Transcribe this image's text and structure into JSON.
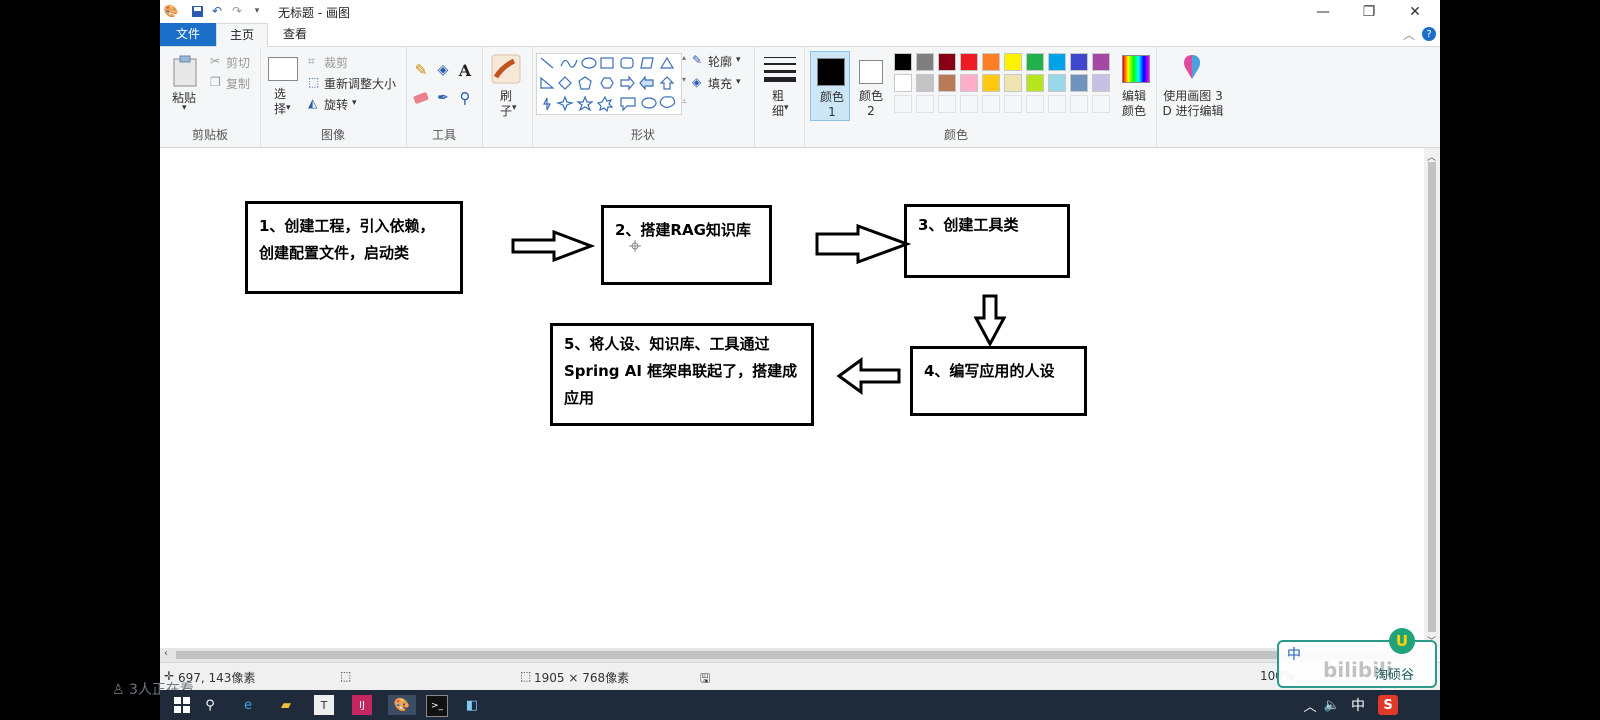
{
  "window": {
    "title": "无标题 - 画图",
    "controls": {
      "minimize": "—",
      "restore": "❐",
      "close": "✕"
    }
  },
  "tabs": {
    "file": "文件",
    "home": "主页",
    "view": "查看"
  },
  "ribbon": {
    "clipboard": {
      "paste": "粘贴",
      "cut": "剪切",
      "copy": "复制",
      "label": "剪贴板"
    },
    "image": {
      "select": "选择",
      "crop": "裁剪",
      "resize": "重新调整大小",
      "rotate": "旋转",
      "label": "图像"
    },
    "tools": {
      "label": "工具"
    },
    "brushes": {
      "label": "刷子"
    },
    "shapes": {
      "outline": "轮廓",
      "fill": "填充",
      "label": "形状"
    },
    "size": {
      "label": "粗细"
    },
    "colors": {
      "color1": "颜色 1",
      "color2": "颜色 2",
      "edit": "编辑颜色",
      "label": "颜色",
      "color1_value": "#000000",
      "color2_value": "#ffffff",
      "palette_row1": [
        "#000000",
        "#7f7f7f",
        "#880015",
        "#ed1c24",
        "#ff7f27",
        "#fff200",
        "#22b14c",
        "#00a2e8",
        "#3f48cc",
        "#a349a4"
      ],
      "palette_row2": [
        "#ffffff",
        "#c3c3c3",
        "#b97a57",
        "#ffaec9",
        "#ffc90e",
        "#efe4b0",
        "#b5e61d",
        "#99d9ea",
        "#7092be",
        "#c8bfe7"
      ]
    },
    "paint3d": {
      "label": "使用画图 3 D 进行编辑"
    }
  },
  "diagram": {
    "steps": [
      {
        "lines": [
          "1、创建工程，引入依赖，",
          "创建配置文件，启动类"
        ]
      },
      {
        "lines": [
          "2、搭建RAG知识库"
        ]
      },
      {
        "lines": [
          "3、创建工具类"
        ]
      },
      {
        "lines": [
          "4、编写应用的人设"
        ]
      },
      {
        "lines": [
          "5、将人设、知识库、工具通过",
          "Spring AI 框架串联起了，搭建成",
          "应用"
        ]
      }
    ]
  },
  "status": {
    "cursor_pos": "697, 143像素",
    "canvas_size": "1905 × 768像素",
    "zoom": "100%"
  },
  "overlay": {
    "viewers": "3人正在看",
    "ime_mode": "中",
    "watermark": "bilibili",
    "badge": "淘硕谷"
  },
  "taskbar": {
    "ime": "中"
  }
}
